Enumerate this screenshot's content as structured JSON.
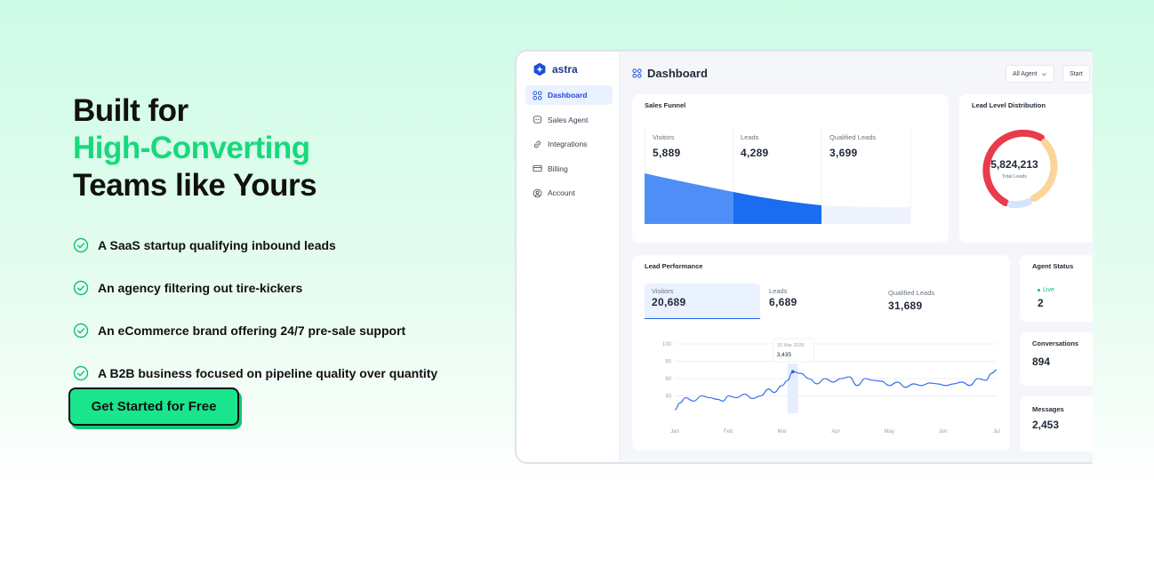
{
  "hero": {
    "line1": "Built for",
    "line2": "High-Converting",
    "line3": "Teams like Yours",
    "bullets": [
      "A SaaS startup qualifying inbound leads",
      "An agency filtering out tire-kickers",
      "An eCommerce brand offering 24/7 pre-sale support",
      "A B2B business focused on pipeline quality over quantity"
    ],
    "cta": "Get Started for Free"
  },
  "app": {
    "brand": "astra",
    "nav": [
      "Dashboard",
      "Sales Agent",
      "Integrations",
      "Billing",
      "Account"
    ],
    "page_title": "Dashboard",
    "filter_agent": "All Agent",
    "filter_start": "Start",
    "sales_funnel": {
      "title": "Sales Funnel",
      "metrics": [
        {
          "label": "Visitors",
          "value": "5,889"
        },
        {
          "label": "Leads",
          "value": "4,289"
        },
        {
          "label": "Qualified Leads",
          "value": "3,699"
        }
      ]
    },
    "lead_level": {
      "title": "Lead Level Distribution",
      "total": "5,824,213",
      "total_label": "Total Leads"
    },
    "lead_performance": {
      "title": "Lead Performance",
      "metrics": [
        {
          "label": "Visitors",
          "value": "20,689"
        },
        {
          "label": "Leads",
          "value": "6,689"
        },
        {
          "label": "Qualified Leads",
          "value": "31,689"
        }
      ],
      "tooltip_date": "15 Mar 2025",
      "tooltip_value": "3,435"
    },
    "agent_status": {
      "title": "Agent Status",
      "status": "Live",
      "value": "2"
    },
    "conversations": {
      "title": "Conversations",
      "value": "894"
    },
    "messages": {
      "title": "Messages",
      "value": "2,453"
    }
  },
  "chart_data": {
    "type": "line",
    "categories": [
      "Jan",
      "Feb",
      "Mar",
      "Apr",
      "May",
      "Jun",
      "Jul"
    ],
    "y_ticks": [
      "100",
      "80",
      "60",
      "40"
    ],
    "ylim": [
      20,
      100
    ],
    "grid": true,
    "x": [
      0,
      0.1,
      0.2,
      0.35,
      0.5,
      0.65,
      0.8,
      0.9,
      1.0,
      1.15,
      1.3,
      1.45,
      1.6,
      1.75,
      1.85,
      2.0,
      2.1,
      2.2,
      2.35,
      2.5,
      2.65,
      2.8,
      2.95,
      3.1,
      3.25,
      3.4,
      3.55,
      3.7,
      3.85,
      4.0,
      4.15,
      4.3,
      4.45,
      4.6,
      4.75,
      4.9,
      5.05,
      5.2,
      5.35,
      5.5,
      5.65,
      5.8,
      5.9,
      6.0
    ],
    "values": [
      24,
      32,
      38,
      34,
      40,
      38,
      36,
      34,
      40,
      38,
      42,
      37,
      40,
      48,
      44,
      52,
      58,
      68,
      66,
      60,
      54,
      60,
      56,
      60,
      62,
      52,
      60,
      58,
      57,
      52,
      56,
      50,
      54,
      52,
      55,
      54,
      52,
      54,
      56,
      52,
      60,
      58,
      66,
      70
    ],
    "highlight": {
      "x": 2.2,
      "label": "15 Mar 2025",
      "value": "3,435"
    },
    "color": "#2563eb"
  }
}
